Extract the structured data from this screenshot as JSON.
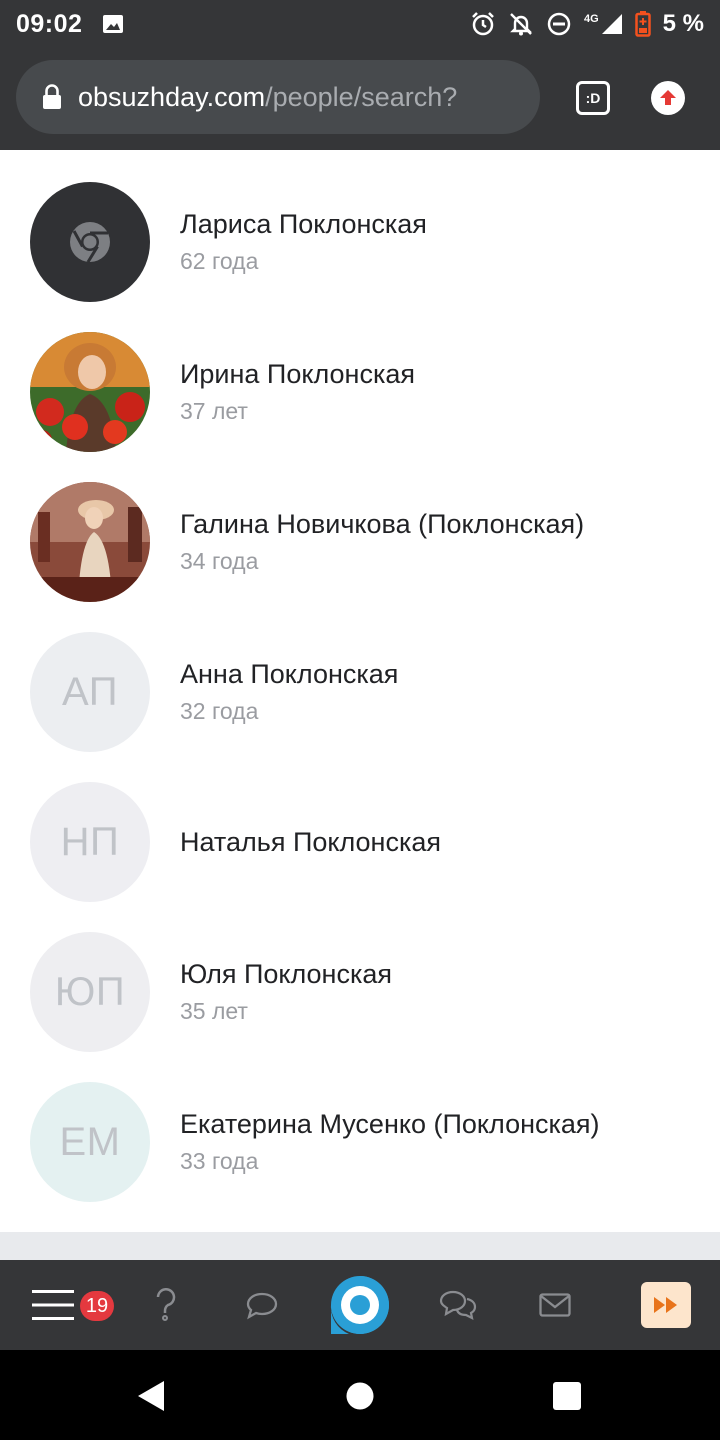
{
  "status_bar": {
    "time": "09:02",
    "network": "4G",
    "battery": "5 %",
    "icons": [
      "gallery-icon",
      "alarm-icon",
      "notifications-off-icon",
      "do-not-disturb-icon",
      "signal-icon",
      "battery-low-icon"
    ]
  },
  "browser": {
    "url_domain": "obsuzhday.com",
    "url_path": "/people/search?",
    "tab_switcher_label": ":D",
    "icons": [
      "lock-icon",
      "upload-icon"
    ]
  },
  "people": [
    {
      "name": "Лариса Поклонская",
      "age": "62 года",
      "avatar": "chrome-icon",
      "avatar_bg": "#303134"
    },
    {
      "name": "Ирина Поклонская",
      "age": "37 лет",
      "avatar": "photo",
      "avatar_bg": "#b02a1e"
    },
    {
      "name": "Галина Новичкова (Поклонская)",
      "age": "34 года",
      "avatar": "photo",
      "avatar_bg": "#7a3a2a"
    },
    {
      "name": "Анна Поклонская",
      "age": "32 года",
      "initials": "АП",
      "avatar_bg": "#eceef1"
    },
    {
      "name": "Наталья Поклонская",
      "age": "",
      "initials": "НП",
      "avatar_bg": "#eeeef2"
    },
    {
      "name": "Юля Поклонская",
      "age": "35 лет",
      "initials": "ЮП",
      "avatar_bg": "#eeeef1"
    },
    {
      "name": "Екатерина Мусенко (Поклонская)",
      "age": "33 года",
      "initials": "ЕМ",
      "avatar_bg": "#e4f1f1"
    }
  ],
  "bottom_nav": {
    "badge_count": "19",
    "items": [
      "menu-icon",
      "question-icon",
      "comment-icon",
      "home-logo-icon",
      "chats-icon",
      "mail-icon",
      "fast-forward-icon"
    ],
    "accent": "#2a9fd6"
  },
  "system_nav": [
    "back-button",
    "home-button",
    "recents-button"
  ]
}
